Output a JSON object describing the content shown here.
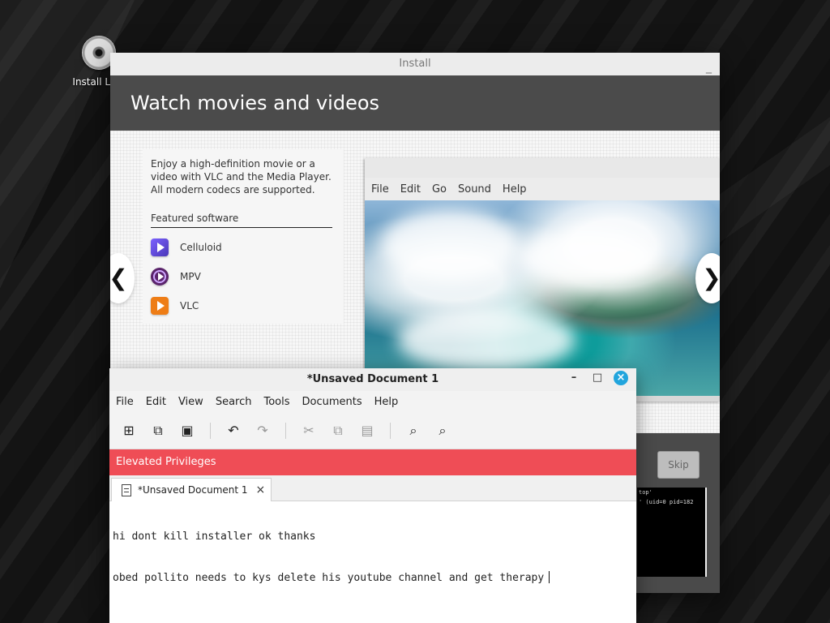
{
  "desktop": {
    "icon_label": "Install Linu"
  },
  "installer": {
    "window_title": "Install",
    "minimize_symbol": "_",
    "hero_title": "Watch movies and videos",
    "description": "Enjoy a high-definition movie or a video with VLC and the Media Player. All modern codecs are supported.",
    "featured_label": "Featured software",
    "software": [
      {
        "name": "Celluloid",
        "icon": "celluloid-icon"
      },
      {
        "name": "MPV",
        "icon": "mpv-icon"
      },
      {
        "name": "VLC",
        "icon": "vlc-icon"
      }
    ],
    "left_arrow": "❮",
    "right_arrow": "❯",
    "skip_label": "Skip",
    "terminal_lines": [
      "top'",
      "' (uid=0 pid=182"
    ]
  },
  "media_player": {
    "menu": [
      "File",
      "Edit",
      "Go",
      "Sound",
      "Help"
    ]
  },
  "editor": {
    "window_title": "*Unsaved Document 1",
    "controls": {
      "minimize": "–",
      "maximize": "□",
      "close": "×"
    },
    "menu": [
      "File",
      "Edit",
      "View",
      "Search",
      "Tools",
      "Documents",
      "Help"
    ],
    "toolbar_icons": [
      "new-document-icon",
      "open-document-icon",
      "save-icon",
      "undo-icon",
      "redo-icon",
      "cut-icon",
      "copy-icon",
      "paste-icon",
      "search-icon",
      "search-replace-icon"
    ],
    "privilege_banner": "Elevated Privileges",
    "tab_title": "*Unsaved Document 1",
    "tab_close": "×",
    "text_lines": [
      "hi dont kill installer ok thanks",
      "obed pollito needs to kys delete his youtube channel and get therapy"
    ]
  }
}
